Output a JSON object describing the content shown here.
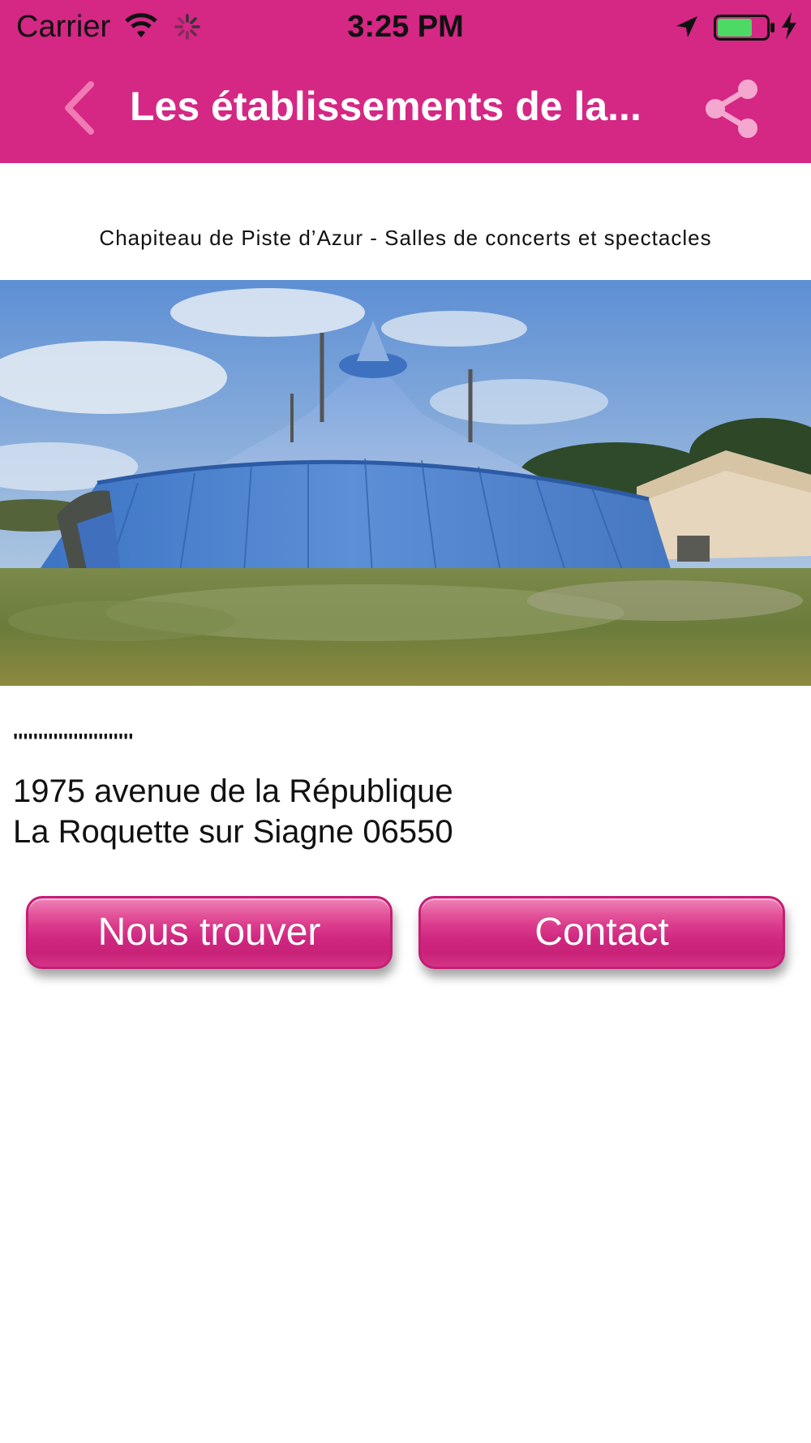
{
  "status_bar": {
    "carrier": "Carrier",
    "time": "3:25 PM",
    "icons": [
      "wifi-icon",
      "activity-spinner-icon",
      "location-arrow-icon",
      "battery-icon",
      "charging-bolt-icon"
    ],
    "battery_color": "#4cd964"
  },
  "nav": {
    "title": "Les établissements de la...",
    "back_icon": "chevron-left-icon",
    "share_icon": "share-icon"
  },
  "venue": {
    "subtitle": "Chapiteau de Piste d’Azur - Salles de concerts et spectacles",
    "rating_dots": "''''''''''''''''''''''''",
    "address_line1": "1975 avenue de la République",
    "address_line2": "La Roquette sur Siagne 06550"
  },
  "buttons": {
    "find_label": "Nous trouver",
    "contact_label": "Contact"
  },
  "colors": {
    "brand": "#d52784",
    "button_border": "#c41d75"
  }
}
